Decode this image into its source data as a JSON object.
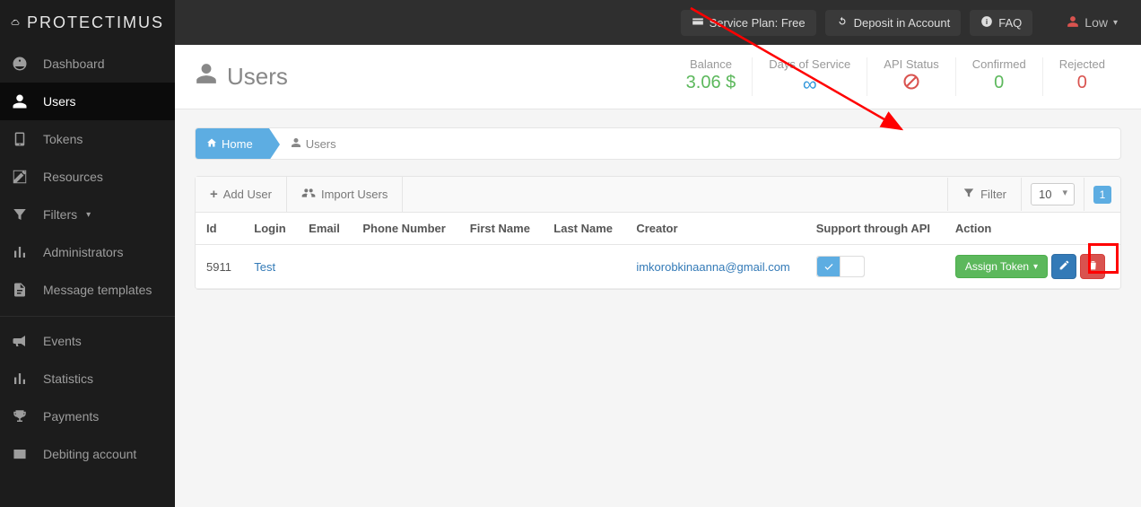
{
  "brand": "PROTECTIMUS",
  "topbar": {
    "service_plan": "Service Plan: Free",
    "deposit": "Deposit in Account",
    "faq": "FAQ",
    "user": "Low"
  },
  "sidebar": {
    "items": [
      {
        "label": "Dashboard",
        "icon": "dashboard-icon"
      },
      {
        "label": "Users",
        "icon": "user-icon"
      },
      {
        "label": "Tokens",
        "icon": "tablet-icon"
      },
      {
        "label": "Resources",
        "icon": "edit-square-icon"
      },
      {
        "label": "Filters",
        "icon": "filter-icon",
        "caret": true
      },
      {
        "label": "Administrators",
        "icon": "bars-icon"
      },
      {
        "label": "Message templates",
        "icon": "file-icon"
      },
      {
        "label": "Events",
        "icon": "bullhorn-icon"
      },
      {
        "label": "Statistics",
        "icon": "bars-icon"
      },
      {
        "label": "Payments",
        "icon": "trophy-icon"
      },
      {
        "label": "Debiting account",
        "icon": "currency-icon"
      }
    ]
  },
  "header": {
    "title": "Users",
    "stats": {
      "balance_label": "Balance",
      "balance_value": "3.06 $",
      "days_label": "Days of Service",
      "api_label": "API Status",
      "confirmed_label": "Confirmed",
      "confirmed_value": "0",
      "rejected_label": "Rejected",
      "rejected_value": "0"
    }
  },
  "breadcrumb": {
    "home": "Home",
    "current": "Users"
  },
  "toolbar": {
    "add_user": "Add User",
    "import_users": "Import Users",
    "filter": "Filter",
    "page_size": "10",
    "page_current": "1"
  },
  "table": {
    "columns": {
      "id": "Id",
      "login": "Login",
      "email": "Email",
      "phone": "Phone Number",
      "first_name": "First Name",
      "last_name": "Last Name",
      "creator": "Creator",
      "support_api": "Support through API",
      "action": "Action"
    },
    "rows": [
      {
        "id": "5911",
        "login": "Test",
        "email": "",
        "phone": "",
        "first_name": "",
        "last_name": "",
        "creator": "imkorobkinaanna@gmail.com",
        "support_api": true
      }
    ],
    "assign_label": "Assign Token"
  }
}
